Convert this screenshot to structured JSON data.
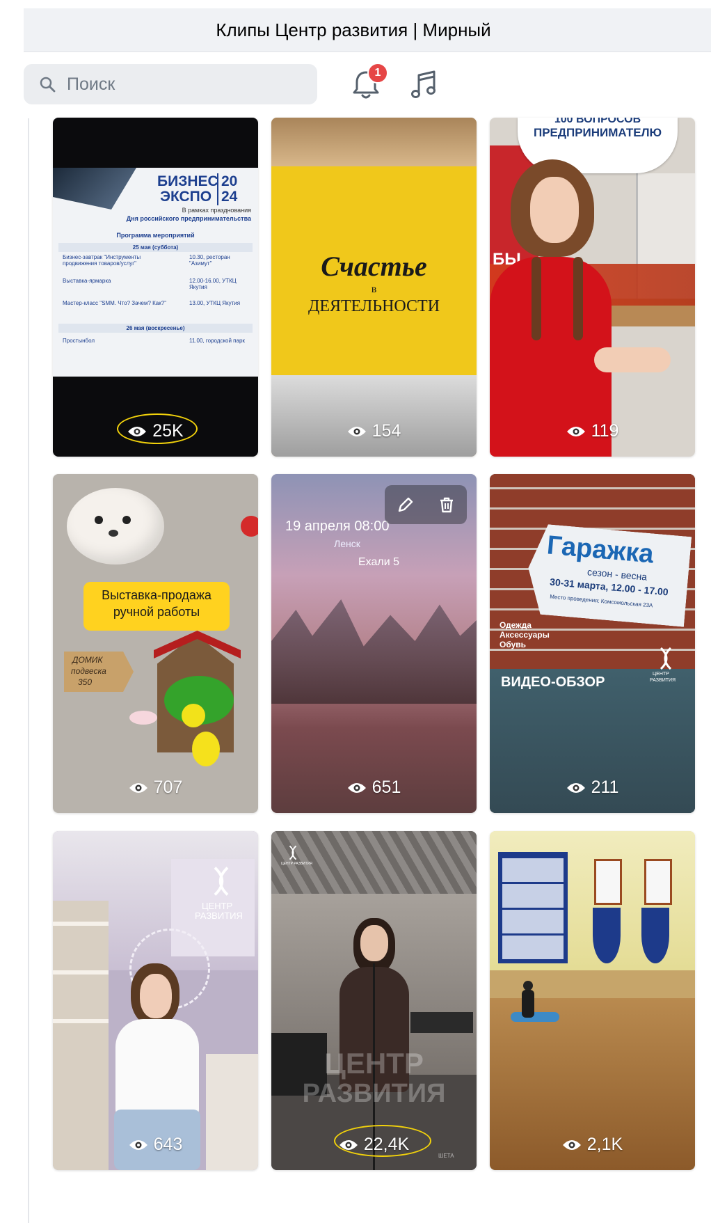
{
  "window": {
    "title": "Клипы Центр развития | Мирный"
  },
  "search": {
    "placeholder": "Поиск"
  },
  "notifications": {
    "count": "1"
  },
  "colors": {
    "accent": "#e64646",
    "highlight_ring": "#f2d20b"
  },
  "clips": [
    {
      "views": "25K",
      "highlighted": true,
      "text": {
        "title_a": "БИЗНЕС",
        "title_b": "ЭКСПО",
        "year_a": "20",
        "year_b": "24",
        "sub1": "В рамках празднования",
        "sub2": "Дня российского предпринимательства",
        "program": "Программа мероприятий",
        "day1": "25 мая (суббота)",
        "day2": "26 мая (воскресенье)",
        "e1": "Бизнес-завтрак \"Инструменты продвижения товаров/услуг\"",
        "t1": "10.30, ресторан \"Азимут\"",
        "e2": "Выставка-ярмарка",
        "t2": "12.00-16.00, УТКЦ Якутия",
        "e3": "Мастер-класс \"SMM. Что? Зачем? Как?\"",
        "t3": "13.00, УТКЦ Якутия",
        "e4": "Простынбол",
        "t4": "11.00, городской парк"
      }
    },
    {
      "views": "154",
      "highlighted": false,
      "text": {
        "l1": "Счастье",
        "l2": "в",
        "l3": "ДЕЯТЕЛЬНОСТИ"
      }
    },
    {
      "views": "119",
      "highlighted": false,
      "text": {
        "bubble_top": "100 ВОПРОСОВ",
        "bubble": "ПРЕДПРИНИМАТЕЛЮ",
        "side": "БЫ"
      }
    },
    {
      "views": "707",
      "highlighted": false,
      "text": {
        "label1": "Выставка-продажа",
        "label2": "ручной работы",
        "tag1": "ДОМИК",
        "tag2": "подвеска",
        "tag3": "350"
      }
    },
    {
      "views": "651",
      "highlighted": false,
      "has_edit_toolbar": true,
      "text": {
        "date": "19 апреля 08:00",
        "line2": "Ленск",
        "line3": "Ехали 5"
      }
    },
    {
      "views": "211",
      "highlighted": false,
      "text": {
        "title": "Гаражка",
        "season": "сезон - весна",
        "dates": "30-31 марта, 12.00 - 17.00",
        "place": "Место проведения: Комсомольская 23А",
        "items1": "Одежда",
        "items2": "Аксессуары",
        "items3": "Обувь",
        "review": "ВИДЕО-ОБЗОР",
        "logo1": "ЦЕНТР",
        "logo2": "РАЗВИТИЯ"
      }
    },
    {
      "views": "643",
      "highlighted": false,
      "text": {
        "logo1": "ЦЕНТР",
        "logo2": "РАЗВИТИЯ"
      }
    },
    {
      "views": "22,4K",
      "highlighted": true,
      "text": {
        "big1": "ЦЕНТР",
        "big2": "РАЗВИТИЯ",
        "corner": "ЦЕНТР РАЗВИТИЯ",
        "mark": "ШЕТА"
      }
    },
    {
      "views": "2,1K",
      "highlighted": false,
      "text": {}
    }
  ]
}
